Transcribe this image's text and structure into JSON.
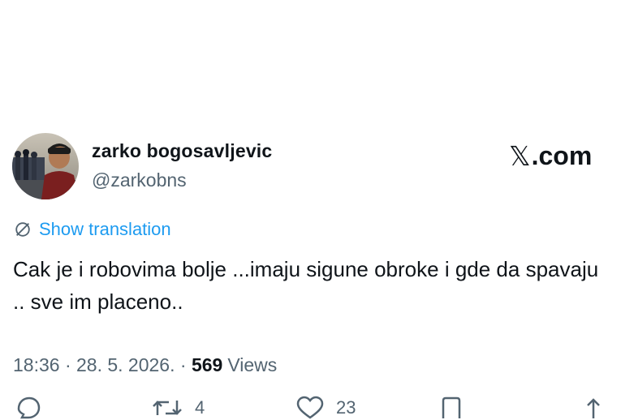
{
  "author": {
    "display_name": "zarko bogosavljevic",
    "handle": "@zarkobns"
  },
  "brand": {
    "label": ".com",
    "icon": "x-logo-icon"
  },
  "translation": {
    "label": "Show translation",
    "icon": "globe-icon",
    "color": "#1d9bf0"
  },
  "tweet": {
    "text": "Cak je i robovima bolje ...imaju sigune obroke i gde da spavaju .. sve im placeno.."
  },
  "meta": {
    "time": "18:36 · 28. 5. 2026. · ",
    "views_count": "569",
    "views_label": "Views"
  },
  "actions": {
    "reply": {
      "icon": "reply-icon",
      "count": ""
    },
    "repost": {
      "icon": "repost-icon",
      "count": "4"
    },
    "like": {
      "icon": "heart-icon",
      "count": "23"
    },
    "bookmark": {
      "icon": "bookmark-icon",
      "count": ""
    },
    "share": {
      "icon": "share-icon",
      "count": ""
    }
  },
  "colors": {
    "text_primary": "#0f1419",
    "text_secondary": "#536471",
    "accent": "#1d9bf0"
  }
}
